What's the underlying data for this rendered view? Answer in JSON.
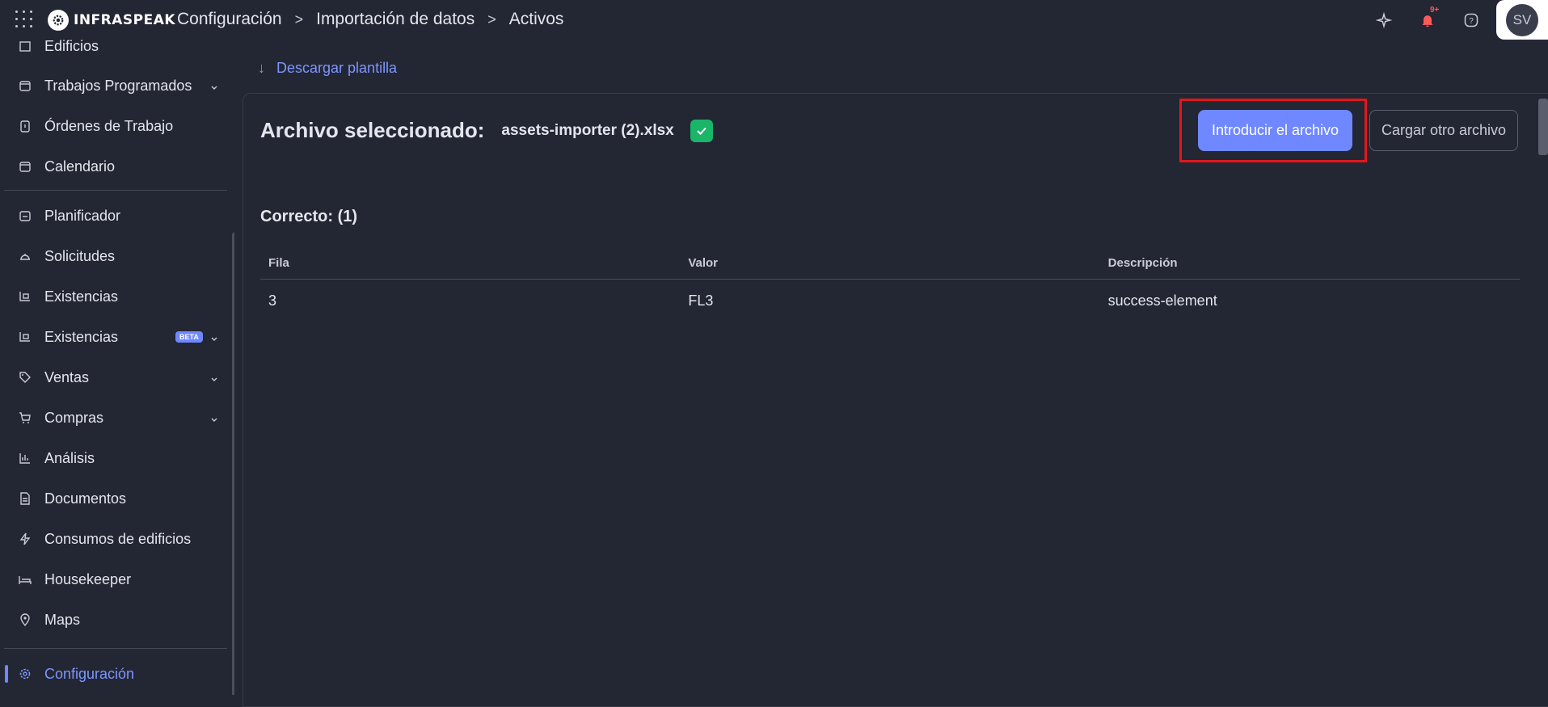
{
  "topbar": {
    "logo_text": "INFRASPEAK",
    "breadcrumb": [
      "Configuración",
      "Importación de datos",
      "Activos"
    ],
    "notification_badge": "9+",
    "avatar_initials": "SV"
  },
  "sidebar": {
    "items": [
      {
        "label": "Edificios"
      },
      {
        "label": "Trabajos Programados"
      },
      {
        "label": "Órdenes de Trabajo"
      },
      {
        "label": "Calendario"
      },
      {
        "label": "Planificador"
      },
      {
        "label": "Solicitudes"
      },
      {
        "label": "Existencias"
      },
      {
        "label": "Existencias",
        "badge": "BETA"
      },
      {
        "label": "Ventas"
      },
      {
        "label": "Compras"
      },
      {
        "label": "Análisis"
      },
      {
        "label": "Documentos"
      },
      {
        "label": "Consumos de edificios"
      },
      {
        "label": "Housekeeper"
      },
      {
        "label": "Maps"
      },
      {
        "label": "Configuración"
      }
    ]
  },
  "main": {
    "download_link": "Descargar plantilla",
    "file_title": "Archivo seleccionado:",
    "file_name": "assets-importer (2).xlsx",
    "primary_button": "Introducir el archivo",
    "secondary_button": "Cargar otro archivo",
    "correct_label": "Correcto: (1)",
    "table": {
      "headers": [
        "Fila",
        "Valor",
        "Descripción"
      ],
      "rows": [
        [
          "3",
          "FL3",
          "success-element"
        ]
      ]
    }
  },
  "colors": {
    "background": "#232633",
    "accent": "#6f87ff",
    "success": "#1bb569",
    "highlight": "#e3171a",
    "alert": "#ff5a5a"
  }
}
